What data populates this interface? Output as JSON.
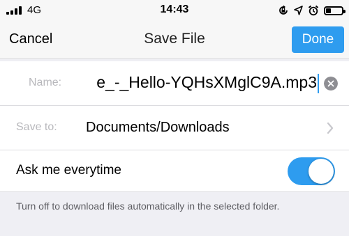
{
  "status_bar": {
    "network": "4G",
    "time": "14:43",
    "icons": [
      "signal-bars-icon",
      "screen-lock-icon",
      "location-arrow-icon",
      "alarm-clock-icon",
      "battery-icon"
    ],
    "battery_level": 0.3
  },
  "nav": {
    "cancel_label": "Cancel",
    "title": "Save File",
    "done_label": "Done",
    "accent_color": "#2e9cef"
  },
  "form": {
    "name_label": "Name:",
    "name_value": "e_-_Hello-YQHsXMglC9A.mp3",
    "save_to_label": "Save to:",
    "save_to_value": "Documents/Downloads",
    "ask_label": "Ask me everytime",
    "ask_enabled": true
  },
  "footer": {
    "note": "Turn off to download files automatically in the selected folder."
  }
}
